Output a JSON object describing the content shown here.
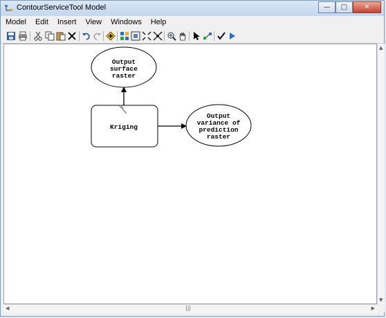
{
  "window": {
    "title": "ContourServiceTool Model",
    "min_glyph": "—",
    "max_glyph": "□",
    "close_glyph": "✕"
  },
  "menu": {
    "items": [
      "Model",
      "Edit",
      "Insert",
      "View",
      "Windows",
      "Help"
    ]
  },
  "toolbar": {
    "icons": [
      "save-icon",
      "print-icon",
      "cut-icon",
      "copy-icon",
      "paste-icon",
      "delete-icon",
      "undo-icon",
      "redo-icon",
      "add-data-icon",
      "auto-layout-icon",
      "full-extent-icon",
      "zoom-in-fixed-icon",
      "zoom-out-fixed-icon",
      "zoom-in-icon",
      "pan-icon",
      "select-icon",
      "connect-icon",
      "validate-icon",
      "run-icon"
    ]
  },
  "diagram": {
    "nodes": {
      "output_surface": {
        "lines": [
          "Output",
          "surface",
          "raster"
        ]
      },
      "kriging": {
        "lines": [
          "Kriging"
        ]
      },
      "output_variance": {
        "lines": [
          "Output",
          "variance of",
          "prediction",
          "raster"
        ]
      }
    }
  },
  "scrollbars": {
    "grip": "|||"
  },
  "colors": {
    "title_gradient_top": "#dbe7f6",
    "close_button": "#c5432d",
    "canvas": "#ffffff",
    "node_stroke": "#000000"
  }
}
